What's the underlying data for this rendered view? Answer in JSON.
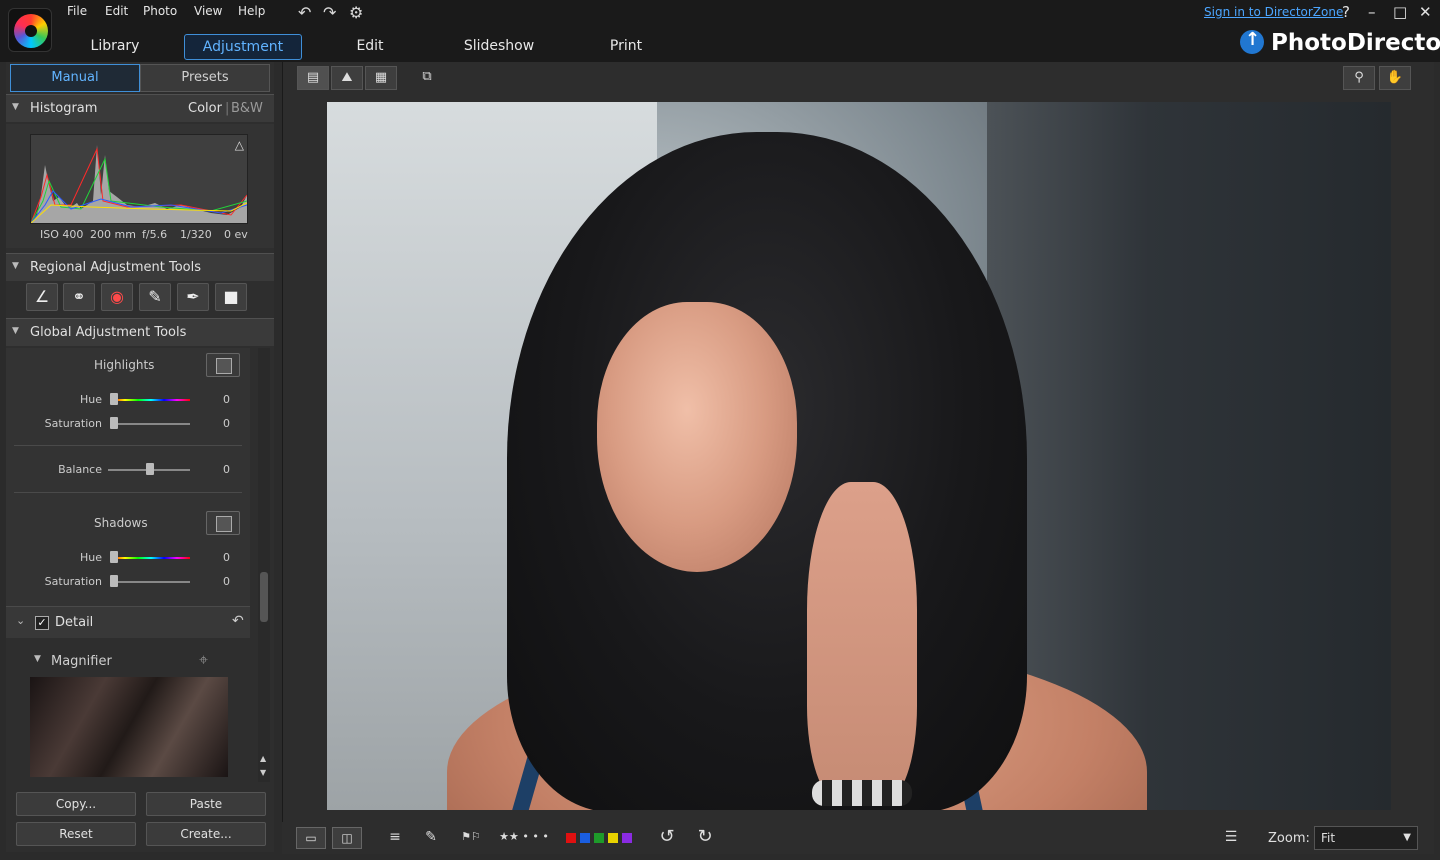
{
  "menu": {
    "items": [
      "File",
      "Edit",
      "Photo",
      "View",
      "Help"
    ],
    "sign_in": "Sign in to DirectorZone",
    "help": "?",
    "minimize": "–",
    "restore": "□",
    "close": "✕"
  },
  "modes": {
    "library": "Library",
    "adjustment": "Adjustment",
    "edit": "Edit",
    "slideshow": "Slideshow",
    "print": "Print"
  },
  "brand": "PhotoDirector",
  "left_panel": {
    "tab_manual": "Manual",
    "tab_presets": "Presets",
    "histogram": {
      "title": "Histogram",
      "mode_color": "Color",
      "separator": "|",
      "mode_bw": "B&W",
      "iso": "ISO 400",
      "focal": "200 mm",
      "aperture": "f/5.6",
      "shutter": "1/320",
      "ev": "0 ev"
    },
    "regional_title": "Regional Adjustment Tools",
    "global_title": "Global Adjustment Tools",
    "highlights": {
      "label": "Highlights",
      "hue_label": "Hue",
      "hue_value": "0",
      "saturation_label": "Saturation",
      "saturation_value": "0"
    },
    "balance": {
      "label": "Balance",
      "value": "0"
    },
    "shadows": {
      "label": "Shadows",
      "hue_label": "Hue",
      "hue_value": "0",
      "saturation_label": "Saturation",
      "saturation_value": "0"
    },
    "detail": {
      "label": "Detail",
      "checked": true
    },
    "magnifier": "Magnifier",
    "buttons": {
      "copy": "Copy...",
      "paste": "Paste",
      "reset": "Reset",
      "create": "Create..."
    }
  },
  "bottombar": {
    "zoom_label": "Zoom:",
    "zoom_value": "Fit",
    "color_labels": [
      "#e01010",
      "#1a5ee0",
      "#1e9b2a",
      "#e8d200",
      "#8a2be2"
    ]
  },
  "colors": {
    "accent": "#3f8fd8",
    "link": "#4ca6ff"
  }
}
